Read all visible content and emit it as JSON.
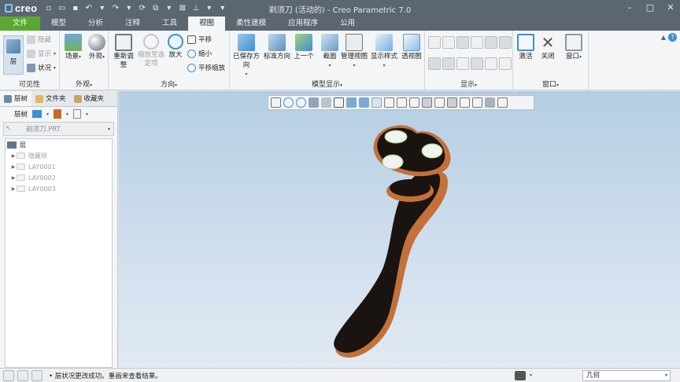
{
  "app": {
    "logo": "creo",
    "window_title": "剃须刀 (活动的) - Creo Parametric 7.0"
  },
  "tabs": [
    "文件",
    "模型",
    "分析",
    "注释",
    "工具",
    "视图",
    "柔性建模",
    "应用程序",
    "公用"
  ],
  "active_tab": "视图",
  "ribbon": {
    "visibility": {
      "label": "可见性",
      "layer": "层",
      "hide": "隐藏",
      "show": "显示",
      "status": "状况"
    },
    "appearance": {
      "label": "外观",
      "scene": "场景",
      "appearance": "外观"
    },
    "orientation": {
      "label": "方向",
      "reorient": "重新调整",
      "zoom_selected": "缩放至选定项",
      "zoom_in": "放大",
      "pan": "平移",
      "zoom_out": "缩小",
      "pan_zoom": "平移缩放"
    },
    "model_display": {
      "label": "模型显示",
      "saved_orient": "已保存方向",
      "std_orient": "标准方向",
      "previous": "上一个",
      "section": "截面",
      "manage_views": "管理视图",
      "display_style": "显示样式",
      "perspective": "透视图"
    },
    "show": {
      "label": "显示"
    },
    "window": {
      "label": "窗口",
      "activate": "激活",
      "close": "关闭",
      "windows": "窗口"
    }
  },
  "left_panel": {
    "tabs": [
      "层树",
      "文件夹",
      "收藏夹"
    ],
    "toolbar_label": "层树",
    "selected_model": "剃须刀.PRT",
    "tree": [
      {
        "label": "层",
        "level": 0,
        "expand": false
      },
      {
        "label": "隐藏项",
        "level": 1,
        "expand": true
      },
      {
        "label": "LAY0001",
        "level": 1,
        "expand": true
      },
      {
        "label": "LAY0002",
        "level": 1,
        "expand": true
      },
      {
        "label": "LAY0003",
        "level": 1,
        "expand": true
      }
    ]
  },
  "status": {
    "message": "• 层状况更改成功。重画来查看结果。",
    "filter_value": "几何"
  },
  "colors": {
    "title_bg": "#5c6670",
    "file_tab": "#5aa832",
    "accent_blue": "#3d8fd1",
    "shaver_body": "#1a1410",
    "shaver_trim": "#c4703a"
  }
}
